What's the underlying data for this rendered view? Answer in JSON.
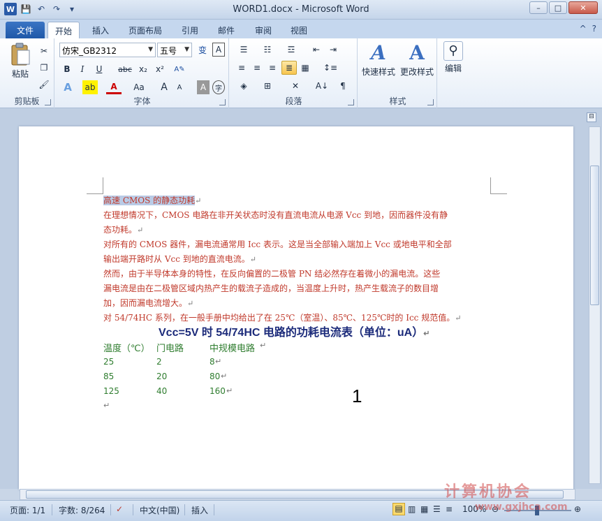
{
  "window": {
    "title": "WORD1.docx - Microsoft Word",
    "min": "–",
    "max": "□",
    "close": "✕"
  },
  "qat": {
    "logo": "W",
    "save": "💾",
    "undo": "↶",
    "redo": "↷",
    "customize": "▾"
  },
  "tabs": {
    "file": "文件",
    "items": [
      "开始",
      "插入",
      "页面布局",
      "引用",
      "邮件",
      "审阅",
      "视图"
    ],
    "active": "开始",
    "help": "?",
    "collapse": "^"
  },
  "ribbon": {
    "clipboard": {
      "label": "剪贴板",
      "paste": "粘贴"
    },
    "font": {
      "label": "字体",
      "font_name": "仿宋_GB2312",
      "font_size": "五号",
      "bold": "B",
      "italic": "I",
      "underline": "U",
      "strike": "abc",
      "subscript": "x₂",
      "superscript": "x²",
      "change_case": "Aa",
      "grow": "A",
      "shrink": "A",
      "phonetic": "变",
      "border_char": "A",
      "shade_char": "A",
      "enclose": "字"
    },
    "paragraph": {
      "label": "段落"
    },
    "styles": {
      "label": "样式",
      "quick": "快速样式",
      "change": "更改样式"
    },
    "editing": {
      "label": "编辑"
    }
  },
  "document": {
    "title_line": "高速 CMOS 的静态功耗",
    "paragraphs": [
      {
        "lines": [
          "在理想情况下，CMOS 电路在非开关状态时没有直流电流从电源 Vcc 到地，因而器件没有静",
          "态功耗。"
        ]
      },
      {
        "lines": [
          "对所有的 CMOS 器件，漏电流通常用 Icc 表示。这是当全部输入端加上 Vcc 或地电平和全部",
          "输出端开路时从 Vcc 到地的直流电流。"
        ]
      },
      {
        "lines": [
          "然而，由于半导体本身的特性，在反向偏置的二极管 PN 结必然存在着微小的漏电流。这些",
          "漏电流是由在二极管区域内热产生的载流子造成的，当温度上升时，热产生载流子的数目增",
          "加，因而漏电流增大。"
        ]
      },
      {
        "lines": [
          "对 54/74HC 系列，在一般手册中均给出了在 25℃（室温）、85℃、125℃时的 Icc 规范值。"
        ]
      }
    ],
    "table_title": "Vcc=5V 时 54/74HC 电路的功耗电流表（单位：uA）",
    "table": {
      "headers": [
        "温度（℃）",
        "门电路",
        "中规模电路"
      ],
      "rows": [
        [
          "25",
          "2",
          "8"
        ],
        [
          "85",
          "20",
          "80"
        ],
        [
          "125",
          "40",
          "160"
        ]
      ]
    },
    "para_mark": "↵",
    "overlay_number": "1"
  },
  "status": {
    "page": "页面: 1/1",
    "words": "字数: 8/264",
    "language": "中文(中国)",
    "mode": "插入",
    "zoom": "100%"
  },
  "watermark": {
    "text": "计算机协会",
    "url": "www.gxjhca.com"
  }
}
